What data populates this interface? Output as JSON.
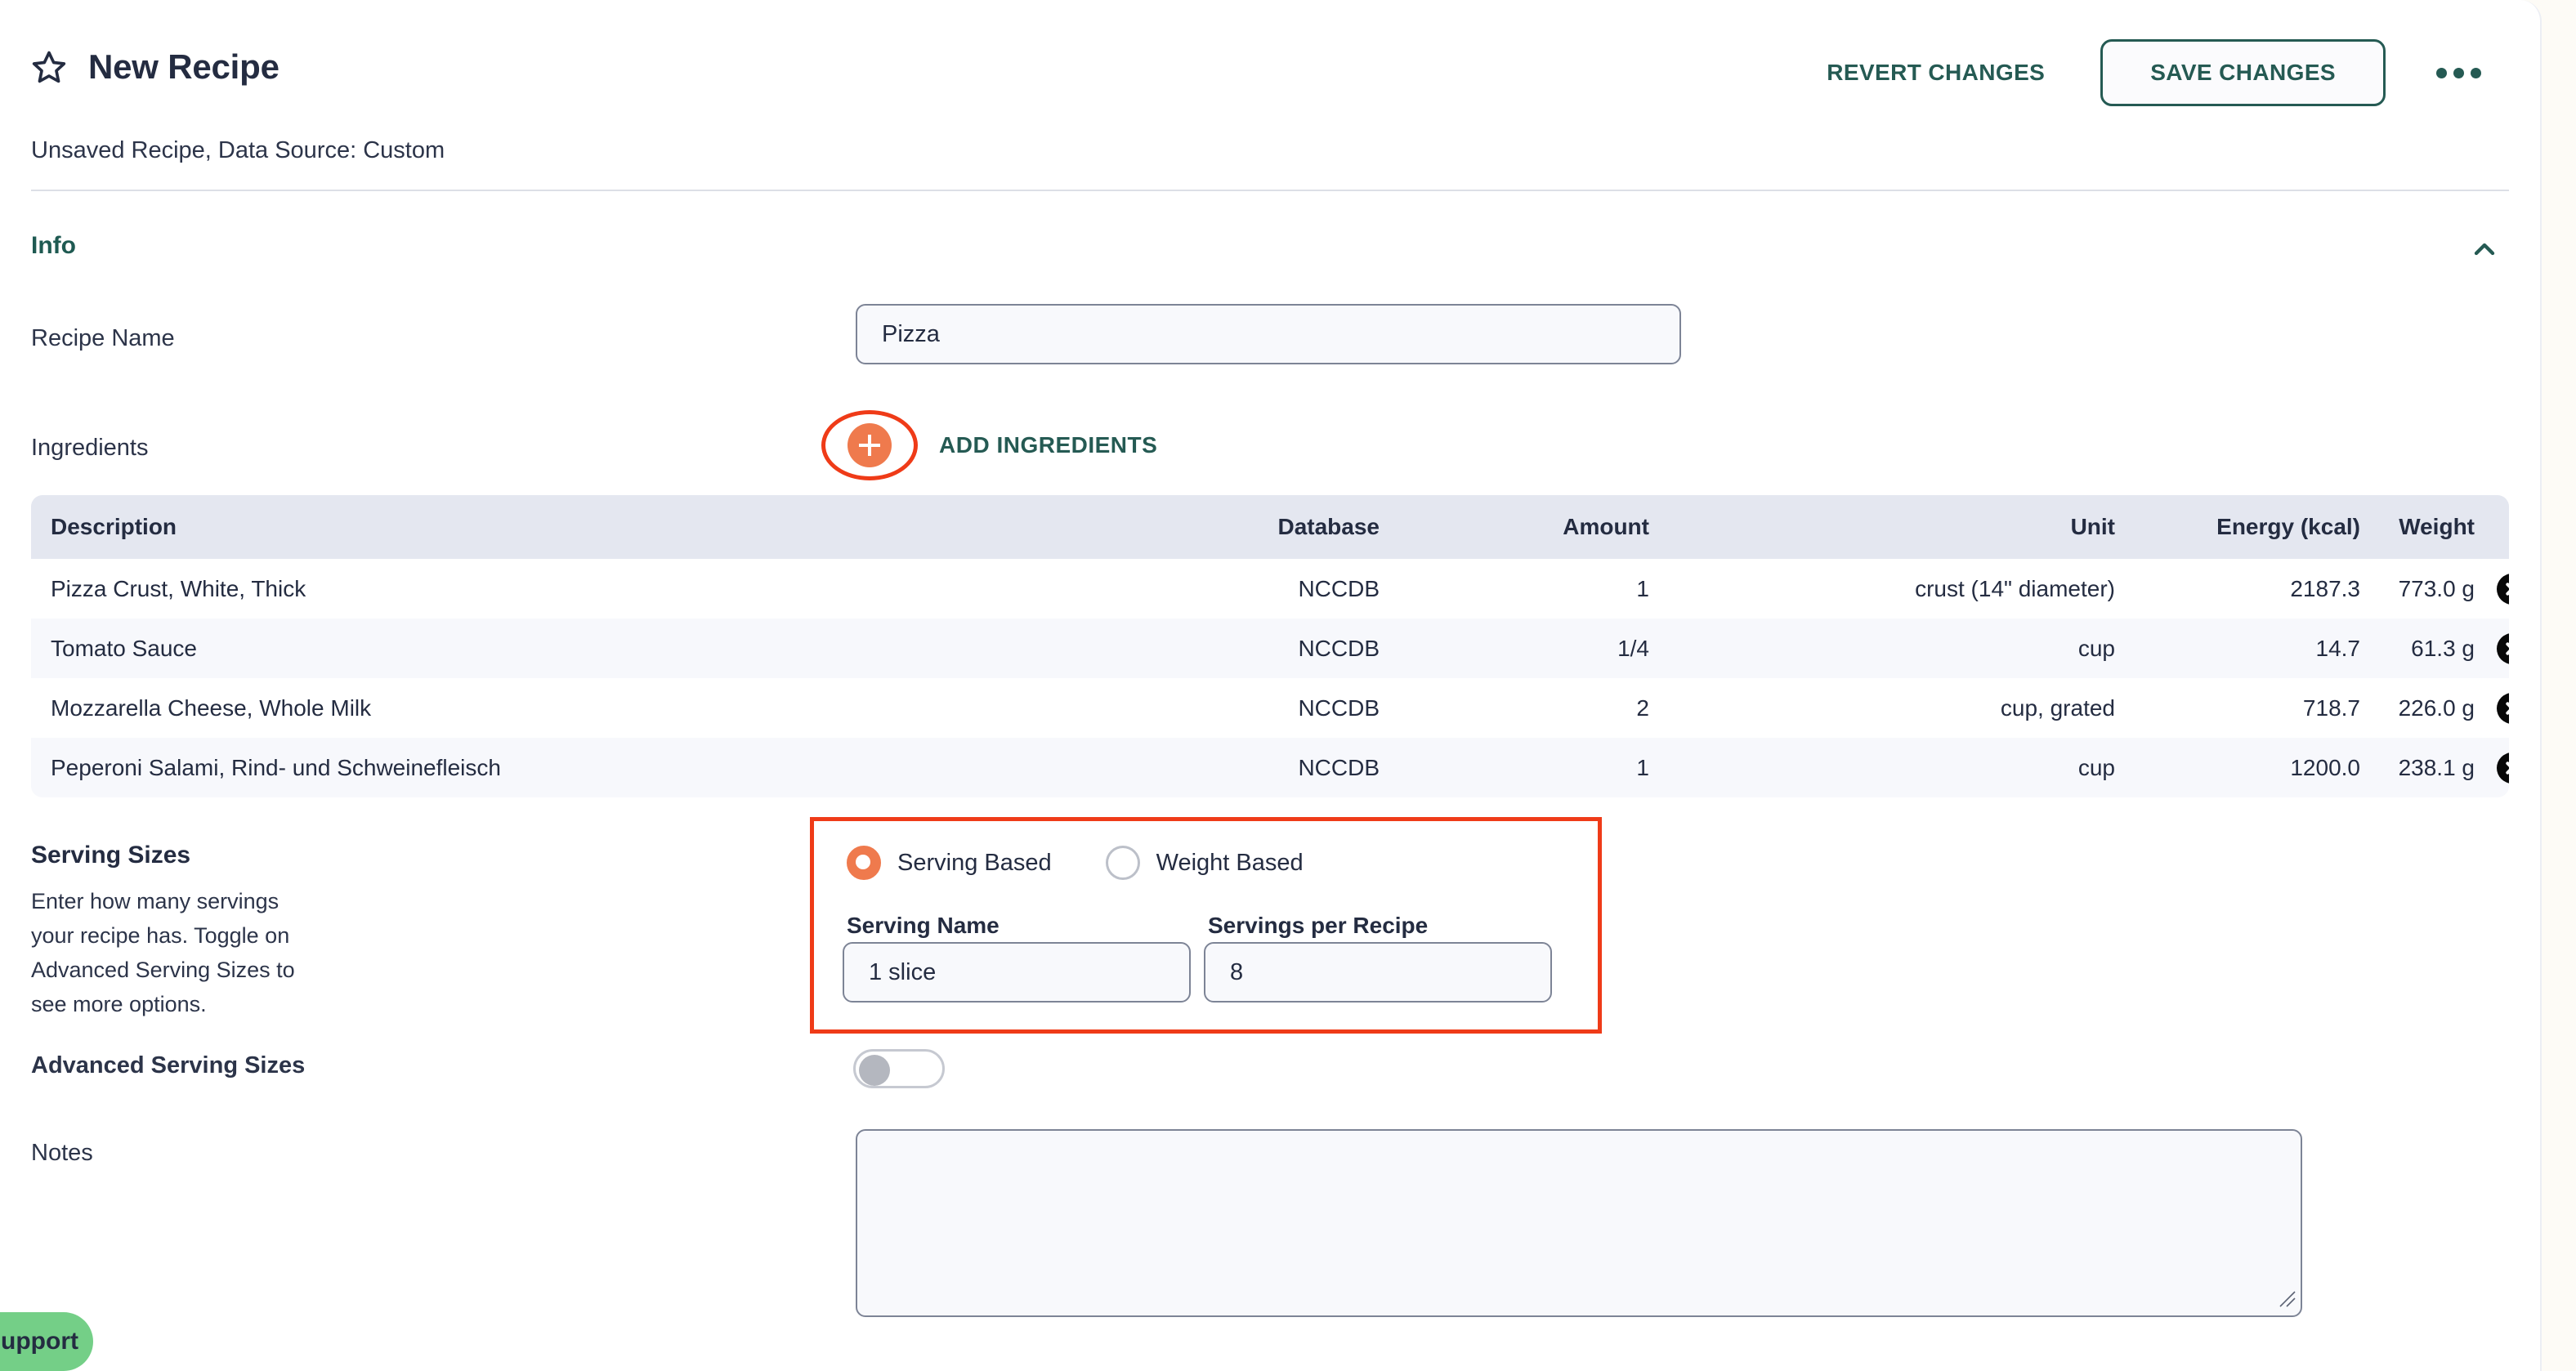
{
  "header": {
    "title": "New Recipe",
    "subtitle": "Unsaved Recipe, Data Source: Custom",
    "star_icon": "star-icon",
    "revert_label": "REVERT CHANGES",
    "save_label": "SAVE CHANGES",
    "more_icon": "ellipsis-icon"
  },
  "info_section": {
    "title": "Info",
    "collapse_icon": "chevron-up-icon"
  },
  "recipe_name": {
    "label": "Recipe Name",
    "value": "Pizza",
    "placeholder": ""
  },
  "ingredients": {
    "label": "Ingredients",
    "add_button_label": "ADD INGREDIENTS",
    "add_icon": "plus-icon",
    "delete_icon": "close-circle-icon",
    "columns": [
      "Description",
      "Database",
      "Amount",
      "Unit",
      "Energy (kcal)",
      "Weight"
    ],
    "rows": [
      {
        "description": "Pizza Crust, White, Thick",
        "database": "NCCDB",
        "amount": "1",
        "unit": "crust (14\" diameter)",
        "energy": "2187.3",
        "weight": "773.0 g"
      },
      {
        "description": "Tomato Sauce",
        "database": "NCCDB",
        "amount": "1/4",
        "unit": "cup",
        "energy": "14.7",
        "weight": "61.3 g"
      },
      {
        "description": "Mozzarella Cheese, Whole Milk",
        "database": "NCCDB",
        "amount": "2",
        "unit": "cup, grated",
        "energy": "718.7",
        "weight": "226.0 g"
      },
      {
        "description": "Peperoni Salami, Rind- und Schweinefleisch",
        "database": "NCCDB",
        "amount": "1",
        "unit": "cup",
        "energy": "1200.0",
        "weight": "238.1 g"
      }
    ]
  },
  "serving_sizes": {
    "title": "Serving Sizes",
    "description": "Enter how many servings your recipe has. Toggle on Advanced Serving Sizes to see more options.",
    "options": [
      {
        "label": "Serving Based",
        "selected": true
      },
      {
        "label": "Weight Based",
        "selected": false
      }
    ],
    "serving_name_label": "Serving Name",
    "serving_name_value": "1 slice",
    "servings_per_recipe_label": "Servings per Recipe",
    "servings_per_recipe_value": "8"
  },
  "advanced_serving_sizes": {
    "label": "Advanced Serving Sizes",
    "enabled": false
  },
  "notes": {
    "label": "Notes",
    "value": "",
    "placeholder": ""
  },
  "support": {
    "label": "Support"
  },
  "colors": {
    "teal": "#255a53",
    "orange": "#ef7a4d",
    "annotation_red": "#ef3b18",
    "text_dark": "#242c41",
    "table_header_bg": "#e4e7f0",
    "support_green": "#74cf87",
    "page_bg": "#fdfbf6"
  }
}
